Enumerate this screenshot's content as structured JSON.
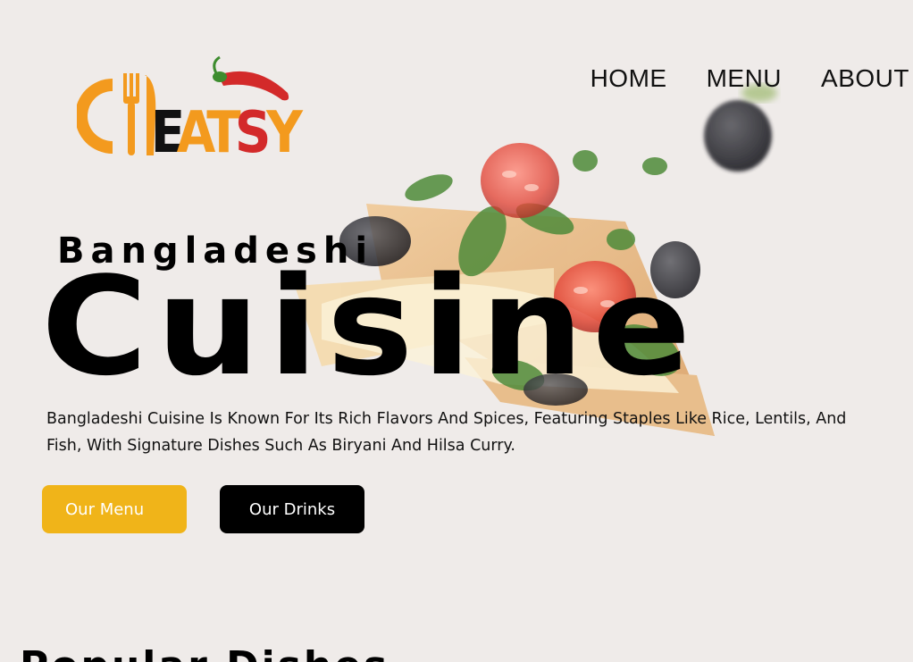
{
  "brand": {
    "name": "EATSY"
  },
  "nav": {
    "items": [
      {
        "label": "HOME"
      },
      {
        "label": "MENU"
      },
      {
        "label": "ABOUT"
      }
    ]
  },
  "hero": {
    "subtitle": "Bangladeshi",
    "title": "Cuisine",
    "description": "Bangladeshi Cuisine Is Known For Its Rich Flavors And Spices, Featuring Staples Like Rice, Lentils, And Fish, With Signature Dishes Such As Biryani And Hilsa Curry.",
    "buttons": {
      "menu": "Our Menu",
      "drinks": "Our Drinks"
    }
  },
  "section": {
    "title": "Popular Dishes"
  },
  "colors": {
    "background": "#efebe9",
    "accent": "#f0b419",
    "dark": "#000000",
    "logo_orange": "#f39a1e",
    "logo_red": "#d32a2a"
  },
  "icons": {
    "logo_mark": "plate-fork-knife-icon",
    "logo_chili": "chili-pepper-icon"
  }
}
